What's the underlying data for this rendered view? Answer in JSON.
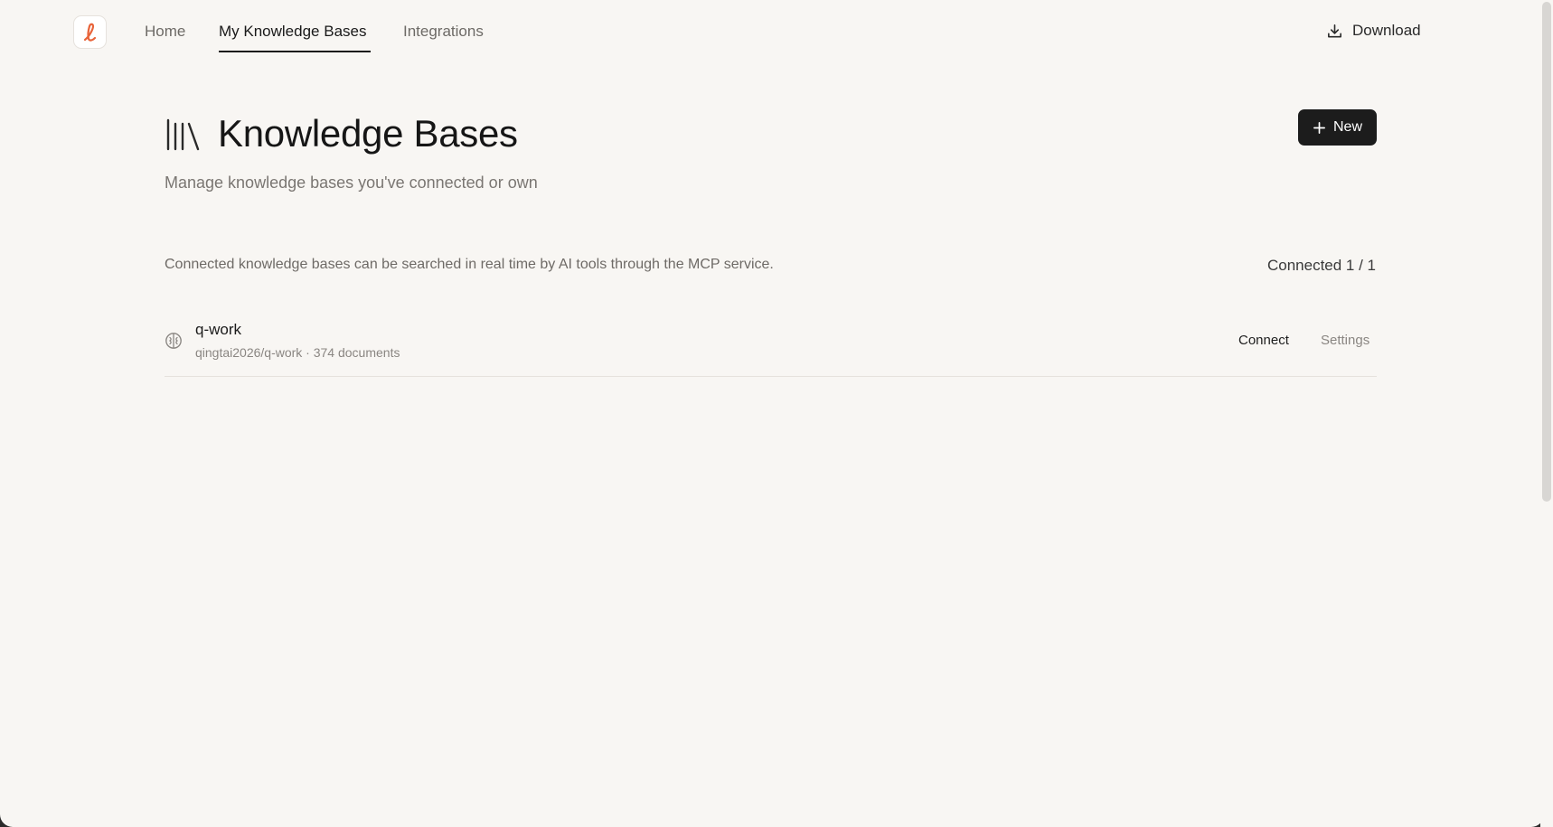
{
  "nav": {
    "items": [
      {
        "label": "Home",
        "active": false
      },
      {
        "label": "My Knowledge Bases",
        "active": true
      },
      {
        "label": "Integrations",
        "active": false
      }
    ],
    "download_label": "Download",
    "logo_icon": "script-l-icon"
  },
  "header": {
    "title": "Knowledge Bases",
    "subtitle": "Manage knowledge bases you've connected or own",
    "new_button_label": "New"
  },
  "info": {
    "description": "Connected knowledge bases can be searched in real time by AI tools through the MCP service.",
    "connected_label": "Connected",
    "connected": 1,
    "total": 1,
    "connected_text": "Connected 1 / 1"
  },
  "knowledge_bases": [
    {
      "name": "q-work",
      "meta": "qingtai2026/q-work · 374 documents",
      "connect_label": "Connect",
      "settings_label": "Settings"
    }
  ],
  "colors": {
    "background": "#f8f6f3",
    "accent": "#e8643a",
    "primary_button": "#1c1c1c"
  }
}
